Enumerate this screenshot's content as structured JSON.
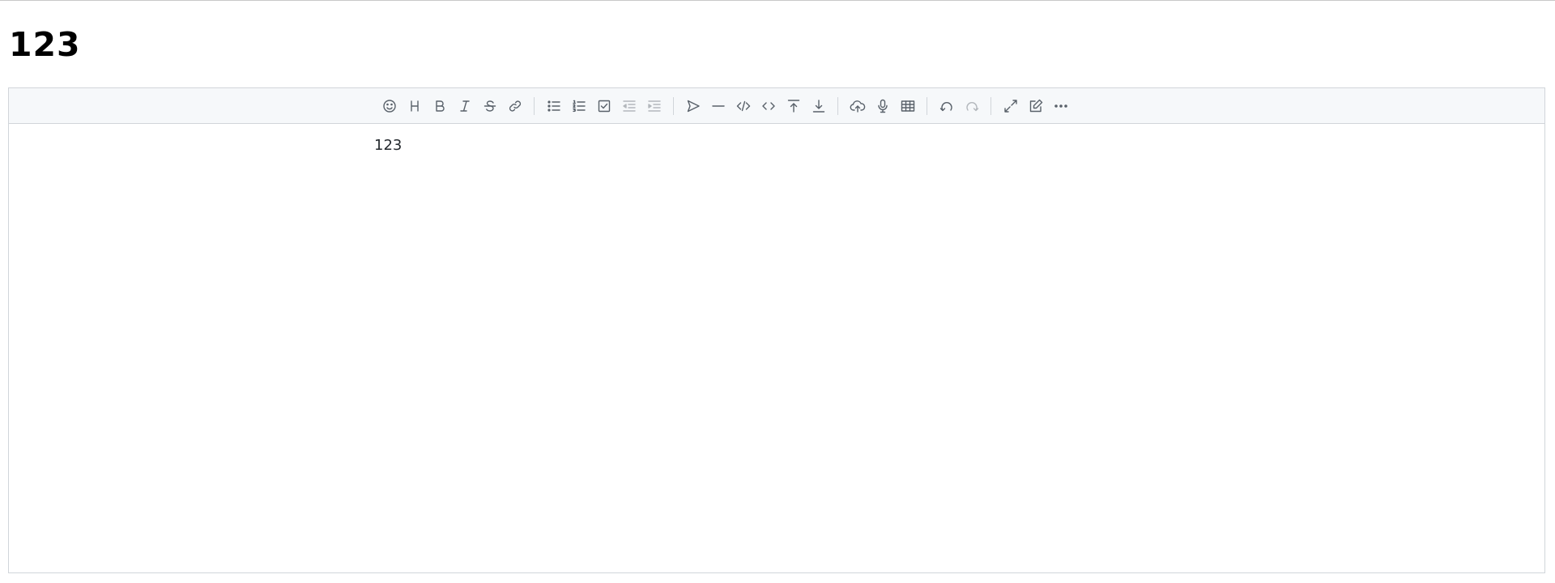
{
  "page": {
    "title": "123"
  },
  "editor": {
    "content": "123"
  },
  "toolbar": {
    "groups": [
      [
        "emoji-icon",
        "heading-icon",
        "bold-icon",
        "italic-icon",
        "strikethrough-icon",
        "link-icon"
      ],
      [
        "unordered-list-icon",
        "ordered-list-icon",
        "check-list-icon",
        "outdent-icon",
        "indent-icon"
      ],
      [
        "quote-icon",
        "horizontal-rule-icon",
        "code-block-icon",
        "inline-code-icon",
        "insert-before-icon",
        "insert-after-icon"
      ],
      [
        "upload-icon",
        "record-icon",
        "table-icon"
      ],
      [
        "undo-icon",
        "redo-icon"
      ],
      [
        "fullscreen-icon",
        "edit-mode-icon",
        "more-icon"
      ]
    ],
    "disabled": [
      "outdent-icon",
      "indent-icon",
      "redo-icon"
    ]
  },
  "colors": {
    "toolbar_bg": "#f6f8fa",
    "border": "#d1d5da",
    "icon": "#586069",
    "text": "#24292e"
  }
}
